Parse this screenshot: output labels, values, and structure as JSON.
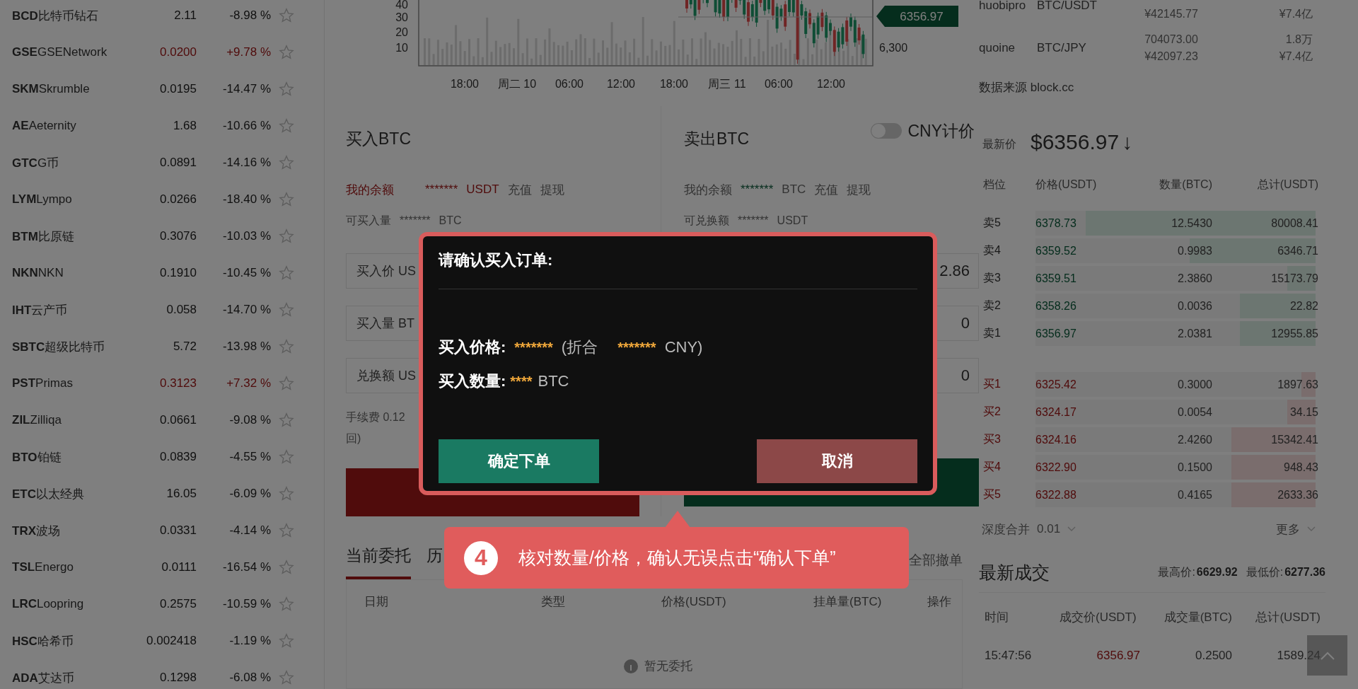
{
  "coin_list": [
    {
      "symbol": "BCD",
      "name": "比特币钻石",
      "price": "2.11",
      "change": "-8.98 %",
      "rising": false,
      "favorite": false
    },
    {
      "symbol": "GSE",
      "name": "GSENetwork",
      "price": "0.0200",
      "change": "+9.78 %",
      "rising": true,
      "favorite": false
    },
    {
      "symbol": "SKM",
      "name": "Skrumble",
      "price": "0.0195",
      "change": "-14.47 %",
      "rising": false,
      "favorite": false
    },
    {
      "symbol": "AE",
      "name": "Aeternity",
      "price": "1.68",
      "change": "-10.66 %",
      "rising": false,
      "favorite": false
    },
    {
      "symbol": "GTC",
      "name": "G币",
      "price": "0.0891",
      "change": "-14.16 %",
      "rising": false,
      "favorite": false
    },
    {
      "symbol": "LYM",
      "name": "Lympo",
      "price": "0.0266",
      "change": "-18.40 %",
      "rising": false,
      "favorite": false
    },
    {
      "symbol": "BTM",
      "name": "比原链",
      "price": "0.3076",
      "change": "-10.03 %",
      "rising": false,
      "favorite": false
    },
    {
      "symbol": "NKN",
      "name": "NKN",
      "price": "0.1910",
      "change": "-10.45 %",
      "rising": false,
      "favorite": false
    },
    {
      "symbol": "IHT",
      "name": "云产币",
      "price": "0.058",
      "change": "-14.70 %",
      "rising": false,
      "favorite": false
    },
    {
      "symbol": "SBTC",
      "name": "超级比特币",
      "price": "5.72",
      "change": "-13.98 %",
      "rising": false,
      "favorite": false
    },
    {
      "symbol": "PST",
      "name": "Primas",
      "price": "0.3123",
      "change": "+7.32 %",
      "rising": true,
      "favorite": false
    },
    {
      "symbol": "ZIL",
      "name": "Zilliqa",
      "price": "0.0661",
      "change": "-9.08 %",
      "rising": false,
      "favorite": false
    },
    {
      "symbol": "BTO",
      "name": "铂链",
      "price": "0.0839",
      "change": "-4.55 %",
      "rising": false,
      "favorite": false
    },
    {
      "symbol": "ETC",
      "name": "以太经典",
      "price": "16.05",
      "change": "-6.09 %",
      "rising": false,
      "favorite": false
    },
    {
      "symbol": "TRX",
      "name": "波场",
      "price": "0.0331",
      "change": "-4.14 %",
      "rising": false,
      "favorite": false
    },
    {
      "symbol": "TSL",
      "name": "Energo",
      "price": "0.0111",
      "change": "-16.54 %",
      "rising": false,
      "favorite": false
    },
    {
      "symbol": "LRC",
      "name": "Loopring",
      "price": "0.2575",
      "change": "-10.59 %",
      "rising": false,
      "favorite": false
    },
    {
      "symbol": "HSC",
      "name": "哈希币",
      "price": "0.002418",
      "change": "-1.19 %",
      "rising": false,
      "favorite": false
    },
    {
      "symbol": "ADA",
      "name": "艾达币",
      "price": "0.1298",
      "change": "-6.08 %",
      "rising": false,
      "favorite": false
    }
  ],
  "chart": {
    "volume_ticks": [
      "40",
      "30",
      "20",
      "10"
    ],
    "time_labels": [
      "18:00",
      "周二 10",
      "06:00",
      "12:00",
      "18:00",
      "周三 11",
      "06:00",
      "12:00"
    ],
    "price_tag": "6356.97",
    "price_label": "6,300"
  },
  "trade_panel": {
    "buy": {
      "title": "买入BTC",
      "balance": {
        "label": "我的余额",
        "value": "*******",
        "unit": "USDT",
        "deposit": "充值",
        "withdraw": "提现"
      },
      "available": {
        "label": "可买入量",
        "value": "*******",
        "unit": "BTC"
      },
      "fields": [
        {
          "placeholder": "买入价 US"
        },
        {
          "placeholder": "买入量 BT"
        },
        {
          "placeholder": "兑换额 US"
        }
      ],
      "fee_lines": [
        "手续费 0.12",
        "回)"
      ]
    },
    "sell": {
      "title": "卖出BTC",
      "balance": {
        "label": "我的余额",
        "value": "*******",
        "unit": "BTC",
        "deposit": "充值",
        "withdraw": "提现"
      },
      "available": {
        "label": "可兑换额",
        "value": "*******",
        "unit": "USDT"
      },
      "fields": [
        {
          "value": "2.86"
        },
        {
          "value": "0"
        },
        {
          "value": "0"
        }
      ]
    },
    "cny_toggle": {
      "label": "CNY计价",
      "on": false
    }
  },
  "orders": {
    "tabs": [
      {
        "label": "当前委托",
        "selected": true
      },
      {
        "label": "历",
        "selected": false
      }
    ],
    "cancel_all": "全部撤单",
    "columns": [
      "日期",
      "类型",
      "价格(USDT)",
      "挂单量(BTC)",
      "操作"
    ],
    "empty": "暂无委托"
  },
  "markets": [
    {
      "exchange": "huobipro",
      "pair": "BTC/USDT",
      "price_cny": "¥42145.77",
      "volume_cny": "¥7.4亿"
    },
    {
      "exchange": "quoine",
      "pair": "BTC/JPY",
      "price": "704073.00",
      "price_cny": "¥42097.23",
      "volume": "1.8万",
      "volume_cny": "¥7.4亿"
    }
  ],
  "source": "数据来源 block.cc",
  "latest_price": {
    "label": "最新价",
    "value": "$6356.97",
    "arrow": "↓"
  },
  "order_book": {
    "columns": [
      "档位",
      "价格(USDT)",
      "数量(BTC)",
      "总计(USDT)"
    ],
    "asks": [
      {
        "label": "卖5",
        "price": "6378.73",
        "amount": "12.5430",
        "total": "80008.41",
        "level": 0.82
      },
      {
        "label": "卖4",
        "price": "6359.52",
        "amount": "0.9983",
        "total": "6346.71",
        "level": 0.45
      },
      {
        "label": "卖3",
        "price": "6359.51",
        "amount": "2.3860",
        "total": "15173.79",
        "level": 0.1
      },
      {
        "label": "卖2",
        "price": "6358.26",
        "amount": "0.0036",
        "total": "22.82",
        "level": 0.27
      },
      {
        "label": "卖1",
        "price": "6356.97",
        "amount": "2.0381",
        "total": "12955.85",
        "level": 0.27
      }
    ],
    "bids": [
      {
        "label": "买1",
        "price": "6325.42",
        "amount": "0.3000",
        "total": "1897.63",
        "level": 0.05
      },
      {
        "label": "买2",
        "price": "6324.17",
        "amount": "0.0054",
        "total": "34.15",
        "level": 0.1
      },
      {
        "label": "买3",
        "price": "6324.16",
        "amount": "2.4260",
        "total": "15342.41",
        "level": 0.3
      },
      {
        "label": "买4",
        "price": "6322.90",
        "amount": "0.1500",
        "total": "948.43",
        "level": 0.3
      },
      {
        "label": "买5",
        "price": "6322.88",
        "amount": "0.4165",
        "total": "2633.36",
        "level": 0.3
      }
    ],
    "depth_label": "深度合并",
    "depth_value": "0.01",
    "more": "更多"
  },
  "latest_trades": {
    "title": "最新成交",
    "high_label": "最高价:",
    "high": "6629.92",
    "low_label": "最低价:",
    "low": "6277.36",
    "columns": [
      "时间",
      "成交价(USDT)",
      "成交量(BTC)",
      "总计(USDT)"
    ],
    "rows": [
      {
        "time": "15:47:56",
        "price": "6356.97",
        "amount": "0.2500",
        "total": "1589.24",
        "rising": false
      }
    ]
  },
  "dialog": {
    "title": "请确认买入订单:",
    "price_label": "买入价格:",
    "price": "*******",
    "cny_open": "(折合",
    "cny": "*******",
    "cny_close": "CNY)",
    "amount_label": "买入数量:",
    "amount": "****",
    "amount_unit": "BTC",
    "confirm": "确定下单",
    "cancel": "取消"
  },
  "callout": {
    "step": "4",
    "text": "核对数量/价格，确认无误点击“确认下单”"
  }
}
